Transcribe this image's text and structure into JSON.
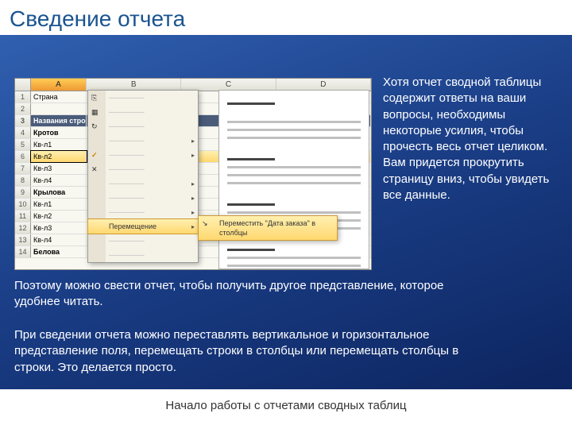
{
  "slide": {
    "title": "Сведение отчета",
    "footer": "Начало работы с отчетами сводных таблиц"
  },
  "text": {
    "right": "Хотя отчет сводной таблицы содержит ответы на ваши вопросы, необходимы некоторые усилия, чтобы прочесть весь отчет целиком. Вам придется прокрутить страницу вниз, чтобы увидеть все данные.",
    "body1": "Поэтому можно свести отчет, чтобы получить другое представление, которое удобнее читать.",
    "body2": "При сведении отчета можно переставлять вертикальное и горизонтальное представление поля, перемещать строки в столбцы или перемещать столбцы в строки. Это делается просто."
  },
  "excel": {
    "cols": [
      "A",
      "B",
      "C",
      "D"
    ],
    "rows": [
      {
        "n": "1",
        "a": "Страна"
      },
      {
        "n": "2",
        "a": ""
      },
      {
        "n": "3",
        "a": "Названия строк",
        "hdr": true
      },
      {
        "n": "4",
        "a": "Кротов",
        "bold": true
      },
      {
        "n": "5",
        "a": "   Кв-л1"
      },
      {
        "n": "6",
        "a": "   Кв-л2",
        "sel": true
      },
      {
        "n": "7",
        "a": "   Кв-л3"
      },
      {
        "n": "8",
        "a": "   Кв-л4"
      },
      {
        "n": "9",
        "a": "Крылова",
        "bold": true
      },
      {
        "n": "10",
        "a": "   Кв-л1"
      },
      {
        "n": "11",
        "a": "   Кв-л2"
      },
      {
        "n": "12",
        "a": "   Кв-л3"
      },
      {
        "n": "13",
        "a": "   Кв-л4"
      },
      {
        "n": "14",
        "a": "Белова",
        "bold": true
      }
    ]
  },
  "contextMenu": {
    "items": [
      {
        "icon": "copy",
        "label": ""
      },
      {
        "icon": "format",
        "label": ""
      },
      {
        "icon": "refresh",
        "label": ""
      },
      {
        "label": "",
        "arrow": true
      },
      {
        "label": "",
        "arrow": true,
        "check": true
      },
      {
        "icon": "x",
        "label": ""
      },
      {
        "label": "",
        "arrow": true
      },
      {
        "label": "",
        "arrow": true
      },
      {
        "label": "",
        "arrow": true
      },
      {
        "label": "Перемещение",
        "arrow": true,
        "hl": true
      },
      {
        "label": ""
      },
      {
        "label": ""
      }
    ]
  },
  "submenu": {
    "item": "Переместить \"Дата заказа\" в столбцы"
  }
}
